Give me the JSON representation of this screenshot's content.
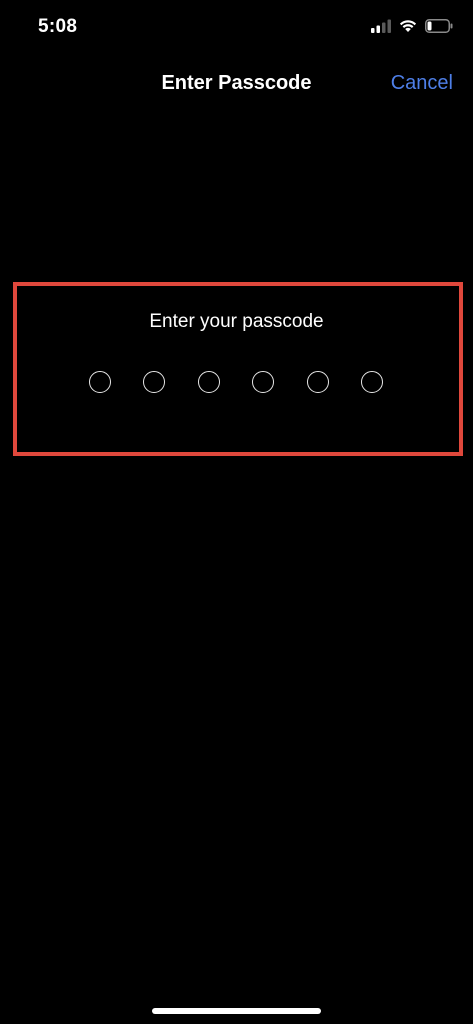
{
  "status_bar": {
    "time": "5:08",
    "icons": [
      "cellular-signal-icon",
      "wifi-icon",
      "battery-icon"
    ],
    "battery_level": 0.2
  },
  "nav": {
    "title": "Enter Passcode",
    "cancel_label": "Cancel"
  },
  "passcode": {
    "prompt": "Enter your passcode",
    "length": 6,
    "entered": 0
  },
  "colors": {
    "background": "#000000",
    "accent": "#4e7fe8",
    "highlight": "#e0483c",
    "text": "#ffffff"
  }
}
